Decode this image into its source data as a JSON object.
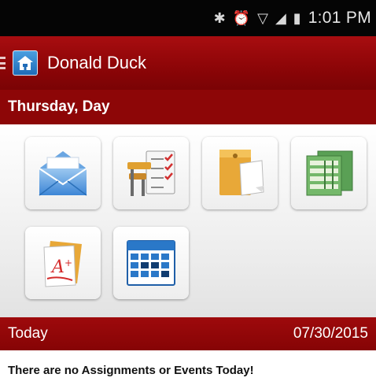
{
  "status_bar": {
    "time": "1:01 PM",
    "icons": [
      "bluetooth-icon",
      "alarm-icon",
      "wifi-icon",
      "lte-icon",
      "signal-icon",
      "battery-icon"
    ]
  },
  "app_bar": {
    "title": "Donald Duck",
    "logo": "school-house-icon",
    "menu": "hamburger-menu-icon"
  },
  "day_header": {
    "label": "Thursday, Day"
  },
  "tiles": [
    {
      "name": "mail-tile",
      "icon": "envelope-icon"
    },
    {
      "name": "attendance-tile",
      "icon": "desk-checklist-icon"
    },
    {
      "name": "documents-tile",
      "icon": "folder-paper-icon"
    },
    {
      "name": "grades-tile",
      "icon": "gradebook-icon"
    },
    {
      "name": "assignments-tile",
      "icon": "graded-paper-icon"
    },
    {
      "name": "calendar-tile",
      "icon": "calendar-icon"
    }
  ],
  "today_bar": {
    "label": "Today",
    "date": "07/30/2015"
  },
  "message": "There are no Assignments or Events Today!",
  "colors": {
    "brand_red": "#8d0607",
    "status_bar": "#050505",
    "accent_blue": "#1f6cb8"
  }
}
